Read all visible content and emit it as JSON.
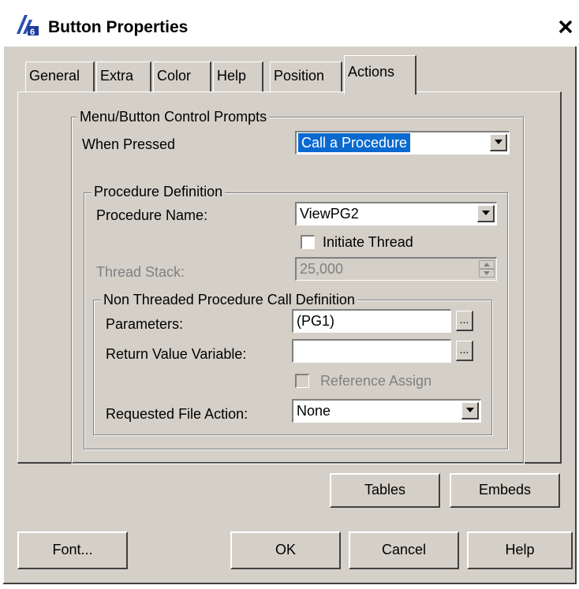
{
  "window": {
    "title": "Button Properties",
    "close_label": "×"
  },
  "tabs": [
    {
      "label": "General",
      "active": false
    },
    {
      "label": "Extra",
      "active": false
    },
    {
      "label": "Color",
      "active": false
    },
    {
      "label": "Help",
      "active": false
    },
    {
      "label": "Position",
      "active": false
    },
    {
      "label": "Actions",
      "active": true
    }
  ],
  "menu_group": {
    "title": "Menu/Button Control Prompts",
    "when_pressed_label": "When Pressed",
    "when_pressed_value": "Call a Procedure"
  },
  "procedure_group": {
    "title": "Procedure Definition",
    "name_label": "Procedure Name:",
    "name_value": "ViewPG2",
    "initiate_thread_label": "Initiate Thread",
    "initiate_thread_checked": false,
    "thread_stack_label": "Thread Stack:",
    "thread_stack_value": "25,000"
  },
  "non_threaded_group": {
    "title": "Non Threaded Procedure Call Definition",
    "parameters_label": "Parameters:",
    "parameters_value": "(PG1)",
    "return_value_label": "Return Value Variable:",
    "return_value_value": "",
    "reference_assign_label": "Reference Assign",
    "reference_assign_checked": false,
    "file_action_label": "Requested File Action:",
    "file_action_value": "None",
    "ellipsis": "..."
  },
  "panel_buttons": {
    "tables": "Tables",
    "embeds": "Embeds"
  },
  "footer_buttons": {
    "font": "Font...",
    "ok": "OK",
    "cancel": "Cancel",
    "help": "Help"
  },
  "colors": {
    "dialog_bg": "#d4d0c8",
    "selection": "#0a6ad0"
  }
}
